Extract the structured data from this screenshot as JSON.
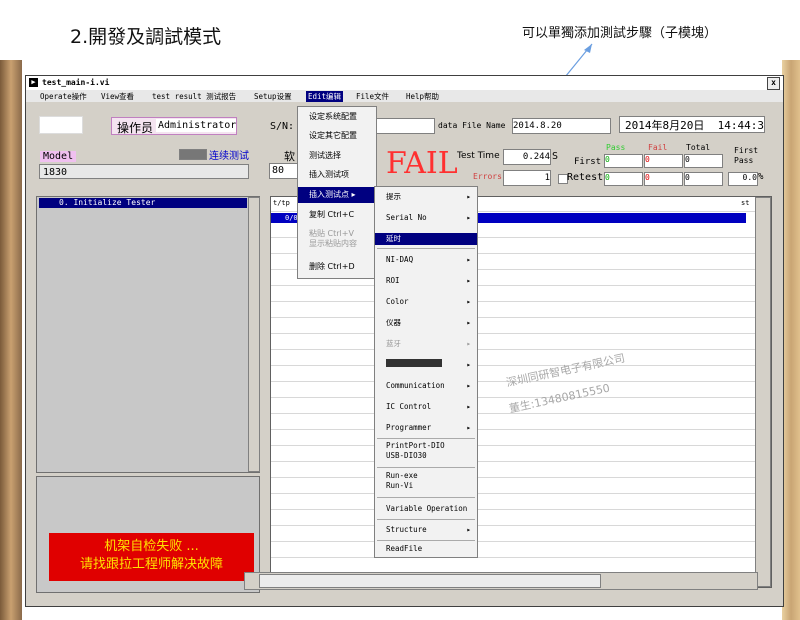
{
  "slide": {
    "title": "2.開發及調試模式",
    "annotation": "可以單獨添加測試步驟（子模塊）"
  },
  "window": {
    "title": "test_main-i.vi",
    "close_glyph": "x",
    "menus": [
      "Operate操作",
      "View查看",
      "test result 测试报告",
      "Setup设置",
      "Edit编辑",
      "File文件",
      "Help帮助"
    ]
  },
  "form": {
    "operator_label": "操作员",
    "operator_value": "Administrator",
    "sn_label": "S/N:",
    "data_file_label": "data File Name",
    "data_file_value": "2014.8.20",
    "date": "2014年8月20日",
    "time": "14:44:37",
    "model_label": "Model",
    "model_value": "1830",
    "continuous_label": "连续测试",
    "soft_label": "软",
    "soft_value": "80",
    "fail_text": "FAIL",
    "test_time_label": "Test Time",
    "test_time_value": "0.244",
    "test_time_unit": "S",
    "errors_label": "Errors",
    "errors_value": "1",
    "first_label": "First",
    "retest_label": "Retest",
    "pass_label": "Pass",
    "fail_label": "Fail",
    "total_label": "Total",
    "first_pass_label": "First Pass",
    "first_pass_value": "0.0",
    "percent": "%",
    "first_row": [
      "0",
      "0",
      "0"
    ],
    "retest_row": [
      "0",
      "0",
      "0"
    ]
  },
  "left_panel": {
    "steps": [
      "0. Initialize Tester"
    ],
    "alarm_line1": "机架自检失败 ...",
    "alarm_line2": "请找跟拉工程师解决故障"
  },
  "grid": {
    "col1_header": "t/tp",
    "first_cell": "0/0",
    "col_last_header": "st"
  },
  "edit_menu": {
    "items": [
      "设定系统配置",
      "设定其它配置",
      "测试选择",
      "插入测试项",
      "插入测试点 ▸",
      "复制   Ctrl+C",
      "粘贴   Ctrl+V",
      "显示粘贴内容",
      "删除   Ctrl+D"
    ]
  },
  "insert_submenu": {
    "items": [
      "提示",
      "Serial No",
      "延时",
      "NI-DAQ",
      "ROI",
      "Color",
      "仪器",
      "蓝牙",
      "",
      "Communication",
      "IC Control",
      "Programmer",
      "PrintPort-DIO",
      "USB-DIO30",
      "Run-exe",
      "Run-Vi",
      "Variable Operation",
      "Structure",
      "ReadFile"
    ]
  },
  "watermark": {
    "line1": "深圳同研智电子有限公司",
    "line2": "董生:13480815550"
  },
  "colors": {
    "accent": "#000080",
    "fail_red": "#ff3030",
    "alarm_bg": "#e00000",
    "alarm_text": "#ffe000"
  }
}
